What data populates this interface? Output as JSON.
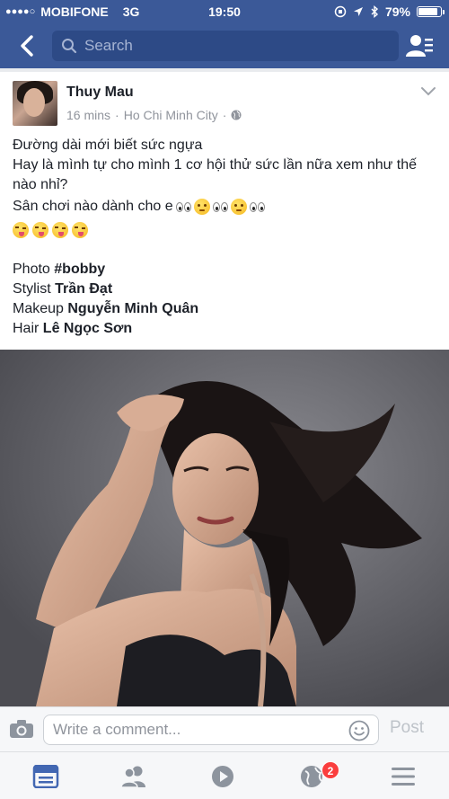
{
  "status_bar": {
    "carrier": "MOBIFONE",
    "network": "3G",
    "time": "19:50",
    "battery": "79%",
    "battery_level": 0.79
  },
  "nav": {
    "search_placeholder": "Search"
  },
  "post": {
    "author": "Thuy Mau",
    "time": "16 mins",
    "separator": "·",
    "location": "Ho Chi Minh City",
    "separator2": "·",
    "lines": [
      "Đường dài mới biết sức ngựa",
      "Hay là mình tự cho mình 1 cơ hội thử sức lần nữa xem như thế nào nhỉ?",
      "Sân chơi nào dành cho e"
    ],
    "credits": [
      {
        "role": "Photo",
        "name": "#bobby"
      },
      {
        "role": "Stylist",
        "name": "Trần Đạt"
      },
      {
        "role": "Makeup",
        "name": "Nguyễn Minh Quân"
      },
      {
        "role": "Hair",
        "name": "Lê Ngọc Sơn"
      }
    ]
  },
  "comment_bar": {
    "placeholder": "Write a comment...",
    "post_label": "Post"
  },
  "tab_bar": {
    "notifications_badge": "2"
  },
  "colors": {
    "brand": "#3b5998",
    "badge": "#fa3e3e",
    "active_tab": "#4267b2"
  }
}
